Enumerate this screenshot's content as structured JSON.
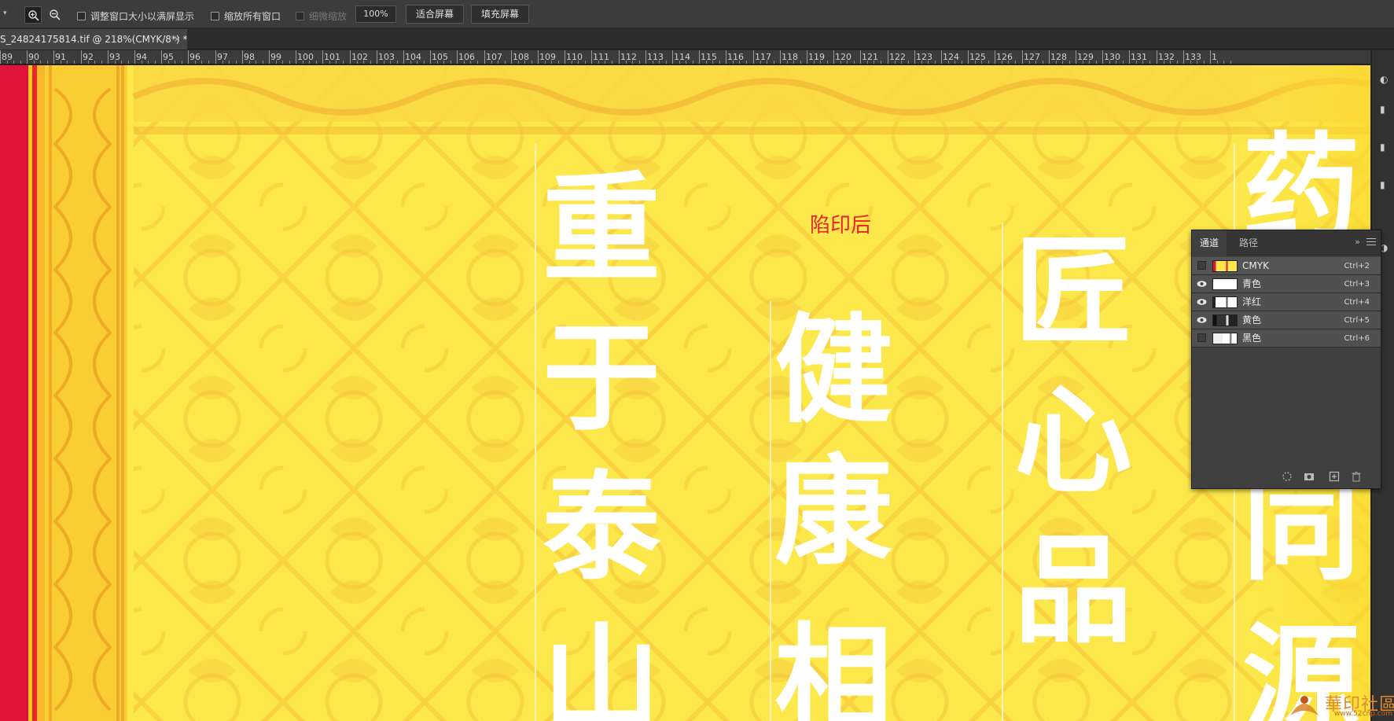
{
  "options_bar": {
    "zoom_in_icon": "zoom-in-icon",
    "zoom_out_icon": "zoom-out-icon",
    "resize_windows_label": "调整窗口大小以满屏显示",
    "zoom_all_windows_label": "缩放所有窗口",
    "scrubby_zoom_label": "细微缩放",
    "zoom_value": "100%",
    "fit_screen_label": "适合屏幕",
    "fill_screen_label": "填充屏幕"
  },
  "document_tab": {
    "title": "S_24824175814.tif @ 218%(CMYK/8*) *",
    "close_glyph": "×"
  },
  "ruler": {
    "labels": [
      "89",
      "90",
      "91",
      "92",
      "93",
      "94",
      "95",
      "96",
      "97",
      "98",
      "99",
      "100",
      "101",
      "102",
      "103",
      "104",
      "105",
      "106",
      "107",
      "108",
      "109",
      "110",
      "111",
      "112",
      "113",
      "114",
      "115",
      "116",
      "117",
      "118",
      "119",
      "120",
      "121",
      "122",
      "123",
      "124",
      "125",
      "126",
      "127",
      "128",
      "129",
      "130",
      "131",
      "132",
      "133",
      "1"
    ]
  },
  "canvas": {
    "annotation": "陷印后",
    "annotation_color": "#e8262e",
    "background_color": "#fce84a",
    "pattern_color": "#f2b733",
    "border_red": "#e0143a",
    "glyph_color": "#ffffff"
  },
  "channels_panel": {
    "tabs": [
      {
        "label": "通道",
        "active": true
      },
      {
        "label": "路径",
        "active": false
      }
    ],
    "collapse_glyph": "»",
    "channels": [
      {
        "name": "CMYK",
        "shortcut": "Ctrl+2",
        "visible": false
      },
      {
        "name": "青色",
        "shortcut": "Ctrl+3",
        "visible": true
      },
      {
        "name": "洋红",
        "shortcut": "Ctrl+4",
        "visible": true
      },
      {
        "name": "黄色",
        "shortcut": "Ctrl+5",
        "visible": true
      },
      {
        "name": "黑色",
        "shortcut": "Ctrl+6",
        "visible": false
      }
    ],
    "footer_icons": [
      "load-selection-icon",
      "save-selection-icon",
      "new-channel-icon",
      "delete-channel-icon"
    ]
  },
  "watermark": {
    "text": "華印社區",
    "url": "www.52cnp.com"
  }
}
